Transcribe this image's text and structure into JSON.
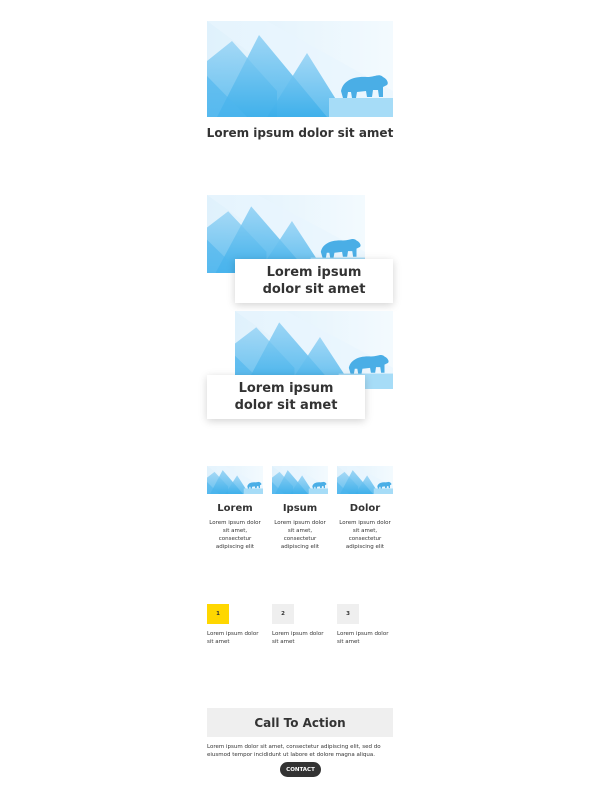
{
  "colors": {
    "sky_light": "#eef7fd",
    "mountain": "#5bb8ee",
    "bear": "#4aaee6",
    "accent_yellow": "#ffd700",
    "box_gray": "#efefef",
    "button_dark": "#333333"
  },
  "section1": {
    "title": "Lorem ipsum dolor sit amet"
  },
  "section2": {
    "cards": [
      {
        "title": "Lorem ipsum dolor sit amet"
      },
      {
        "title": "Lorem ipsum dolor sit amet"
      }
    ]
  },
  "section3": {
    "columns": [
      {
        "title": "Lorem",
        "text": "Lorem ipsum dolor sit amet, consectetur adipiscing elit"
      },
      {
        "title": "Ipsum",
        "text": "Lorem ipsum dolor sit amet, consectetur adipiscing elit"
      },
      {
        "title": "Dolor",
        "text": "Lorem ipsum dolor sit amet, consectetur adipiscing elit"
      }
    ]
  },
  "section4": {
    "steps": [
      {
        "number": "1",
        "text": "Lorem ipsum dolor sit amet"
      },
      {
        "number": "2",
        "text": "Lorem ipsum dolor sit amet"
      },
      {
        "number": "3",
        "text": "Lorem ipsum dolor sit amet"
      }
    ]
  },
  "section5": {
    "title": "Call To Action",
    "text": "Lorem ipsum dolor sit amet, consectetur adipiscing elit, sed do eiusmod tempor incididunt ut labore et dolore magna aliqua.",
    "button_label": "CONTACT"
  }
}
